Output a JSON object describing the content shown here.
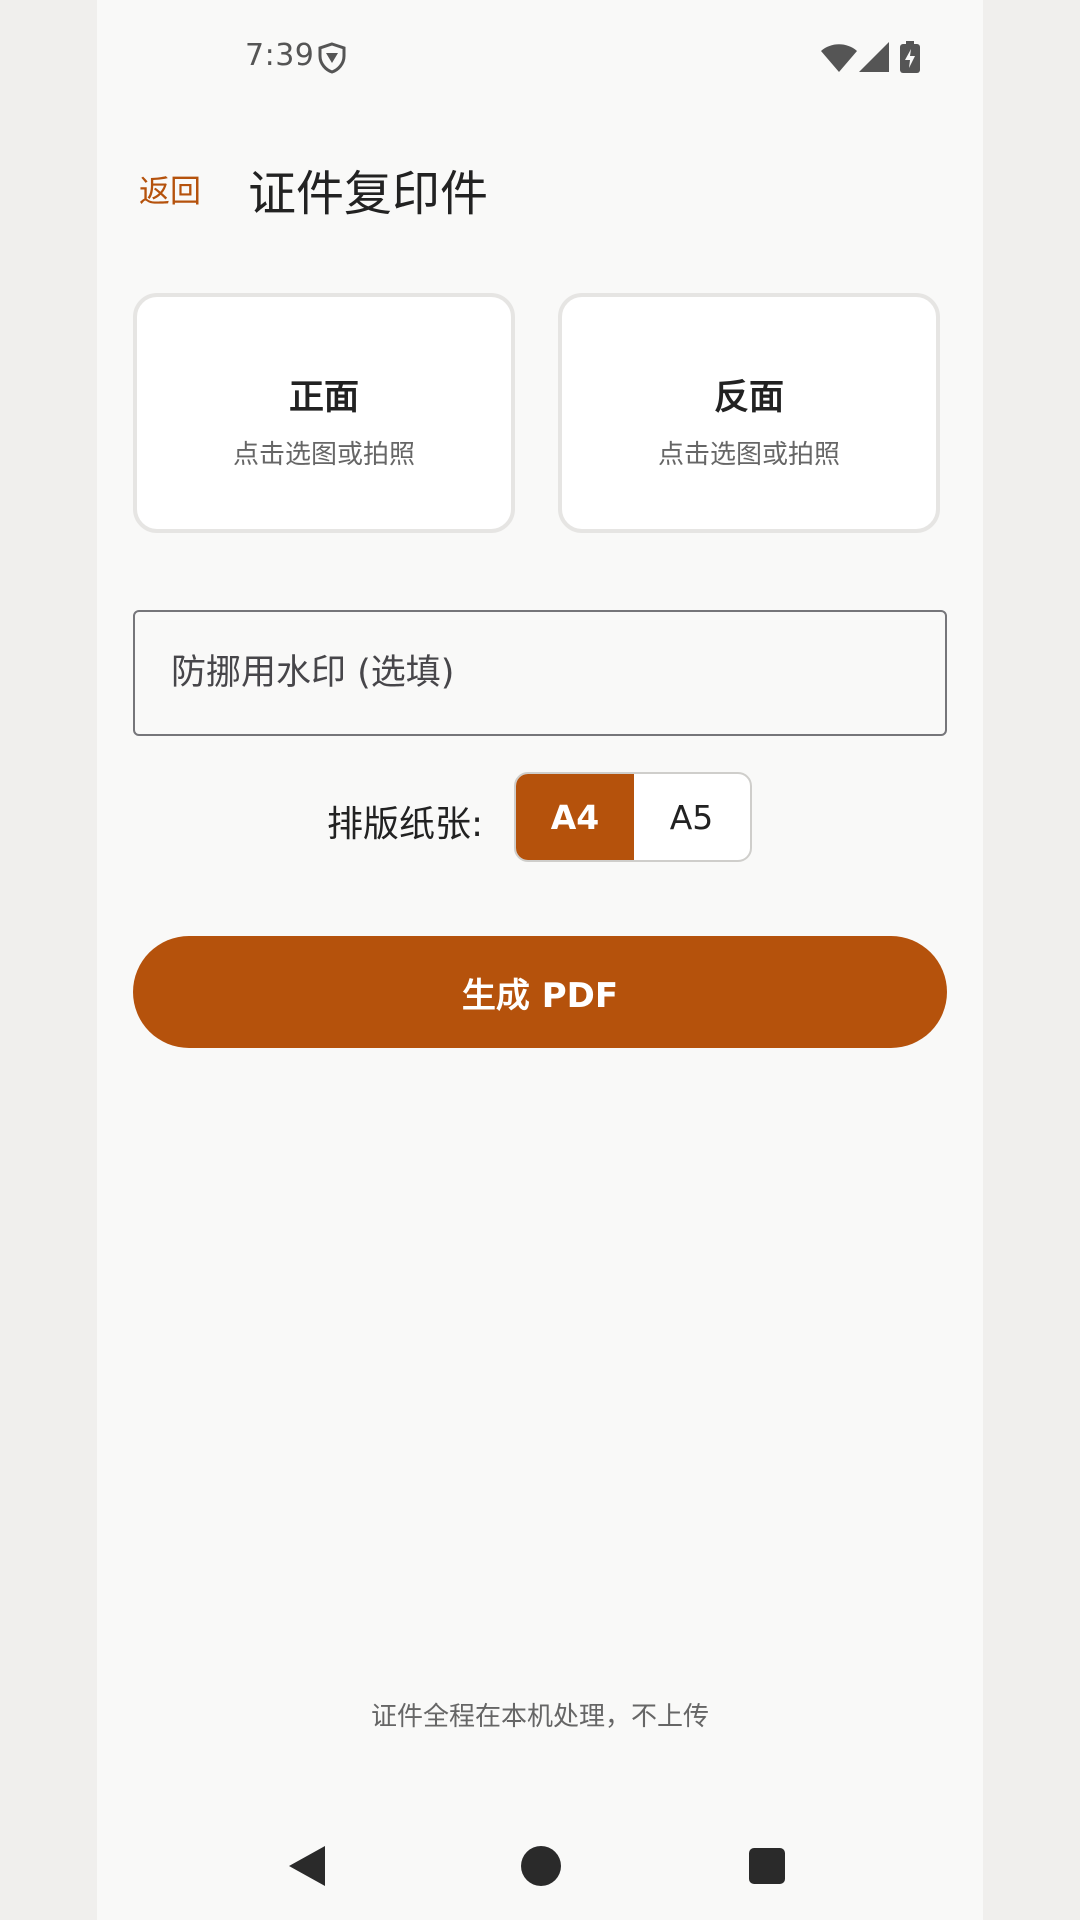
{
  "status_bar": {
    "time": "7:39",
    "icons": [
      "shield-icon",
      "wifi-icon",
      "signal-icon",
      "battery-icon"
    ]
  },
  "header": {
    "back_label": "返回",
    "title": "证件复印件"
  },
  "cards": {
    "front": {
      "title": "正面",
      "subtitle": "点击选图或拍照"
    },
    "back": {
      "title": "反面",
      "subtitle": "点击选图或拍照"
    }
  },
  "watermark": {
    "placeholder": "防挪用水印 (选填)",
    "value": ""
  },
  "paper": {
    "label": "排版纸张:",
    "options": [
      "A4",
      "A5"
    ],
    "selected": "A4"
  },
  "generate_button": {
    "label": "生成 PDF"
  },
  "footer": {
    "note": "证件全程在本机处理，不上传"
  },
  "colors": {
    "accent": "#b5520c",
    "background": "#f9f9f8",
    "card_border": "#e6e5e3"
  },
  "nav": {
    "icons": [
      "nav-back-icon",
      "nav-home-icon",
      "nav-recent-icon"
    ]
  }
}
